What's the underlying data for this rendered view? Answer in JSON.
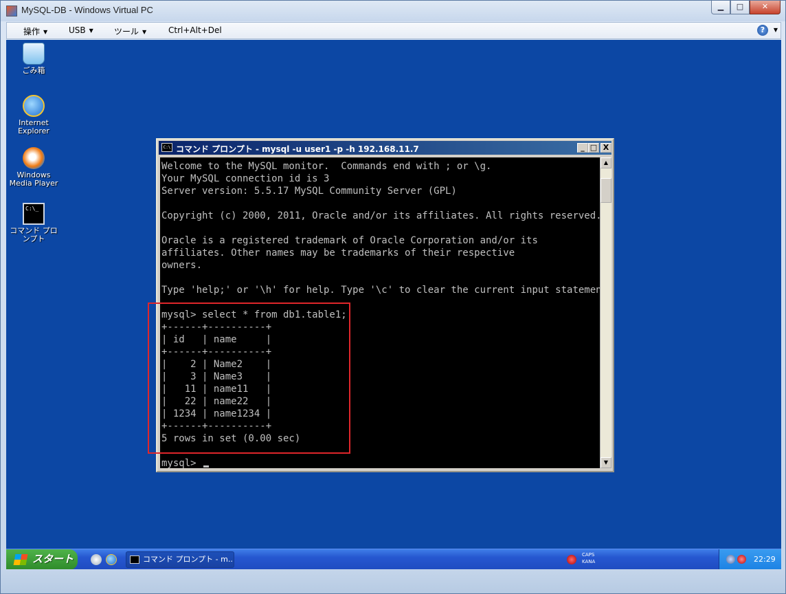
{
  "host": {
    "title": "MySQL-DB - Windows Virtual PC",
    "controls": {
      "minimize": "▁",
      "maximize": "□",
      "close": "✕"
    }
  },
  "menubar": {
    "items": [
      {
        "label": "操作"
      },
      {
        "label": "USB"
      },
      {
        "label": "ツール"
      },
      {
        "label": "Ctrl+Alt+Del"
      }
    ],
    "help_glyph": "?"
  },
  "desktop": {
    "icons": [
      {
        "label": "ごみ箱",
        "icon": "recycle-bin-icon"
      },
      {
        "label": "Internet Explorer",
        "icon": "internet-explorer-icon"
      },
      {
        "label": "Windows Media Player",
        "icon": "media-player-icon"
      },
      {
        "label": "コマンド プロンプト",
        "icon": "command-prompt-icon"
      }
    ]
  },
  "cmd_window": {
    "title": "コマンド プロンプト - mysql -u user1 -p -h 192.168.11.7",
    "icon_glyph": "C:\\",
    "controls": {
      "minimize": "_",
      "maximize": "□",
      "close": "X"
    },
    "lines": [
      "Welcome to the MySQL monitor.  Commands end with ; or \\g.",
      "Your MySQL connection id is 3",
      "Server version: 5.5.17 MySQL Community Server (GPL)",
      "",
      "Copyright (c) 2000, 2011, Oracle and/or its affiliates. All rights reserved.",
      "",
      "Oracle is a registered trademark of Oracle Corporation and/or its",
      "affiliates. Other names may be trademarks of their respective",
      "owners.",
      "",
      "Type 'help;' or '\\h' for help. Type '\\c' to clear the current input statement.",
      "",
      "mysql> select * from db1.table1;",
      "+------+----------+",
      "| id   | name     |",
      "+------+----------+",
      "|    2 | Name2    |",
      "|    3 | Name3    |",
      "|   11 | name11   |",
      "|   22 | name22   |",
      "| 1234 | name1234 |",
      "+------+----------+",
      "5 rows in set (0.00 sec)",
      ""
    ],
    "prompt": "mysql> ",
    "scroll_up": "▲",
    "scroll_down": "▼"
  },
  "annotation": {
    "color": "#e0262b"
  },
  "taskbar": {
    "start_label": "スタート",
    "task_label": "コマンド プロンプト - m...",
    "ime_caps": "CAPS",
    "ime_kana": "KANA",
    "clock": "22:29"
  },
  "colors": {
    "desktop": "#0c47a4",
    "console_bg": "#000000",
    "console_text": "#c0c0c0",
    "title_active": "#0a246a"
  }
}
